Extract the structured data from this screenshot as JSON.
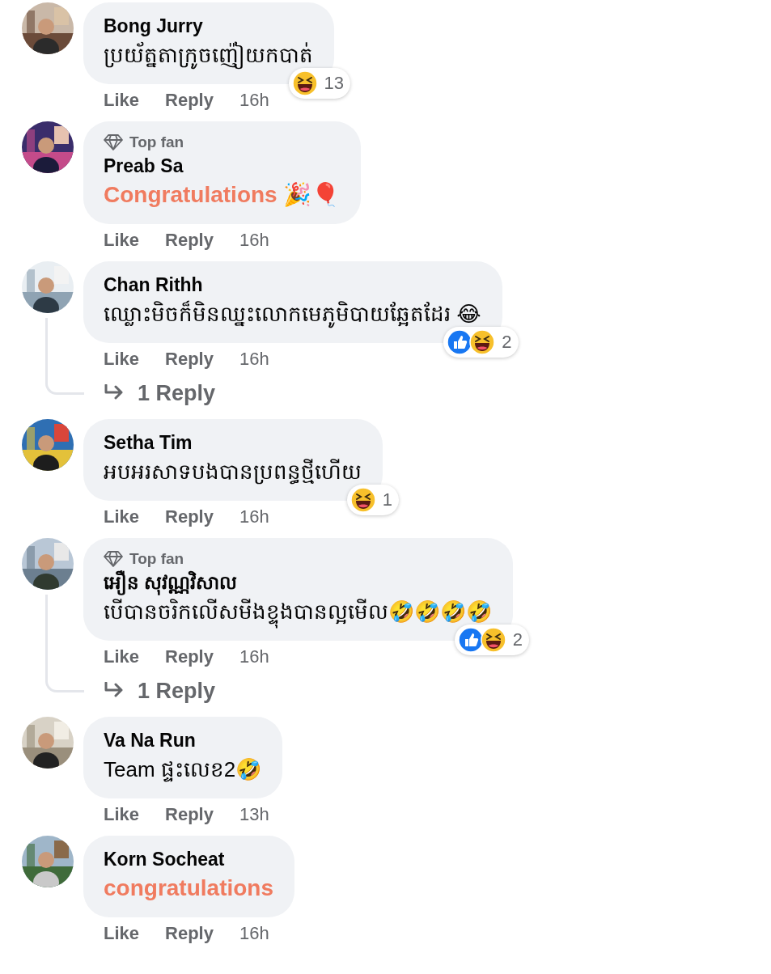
{
  "comments": [
    {
      "author": "Bong Jurry",
      "text": "ប្រយ័ត្នតាក្រូចញ៉ៀយកបាត់",
      "kind": "plain",
      "reactions": [
        {
          "kind": "haha"
        }
      ],
      "reaction_count": "13",
      "actions": [
        "Like",
        "Reply"
      ],
      "time": "16h"
    },
    {
      "badge": "Top fan",
      "author": "Preab Sa",
      "text": "Congratulations 🎉🎈",
      "kind": "celebration",
      "actions": [
        "Like",
        "Reply"
      ],
      "time": "16h"
    },
    {
      "author": "Chan Rithh",
      "text": "ឈ្លោះមិចក៏មិនឈ្នះលោកមេភូមិបាយឆ្អែតដែរ 😂",
      "kind": "plain",
      "reactions": [
        {
          "kind": "like"
        },
        {
          "kind": "haha"
        }
      ],
      "reaction_count": "2",
      "actions": [
        "Like",
        "Reply"
      ],
      "time": "16h",
      "replies_link": "1 Reply"
    },
    {
      "author": "Setha Tim",
      "text": "អបអរសាទបងបានប្រពន្ធថ្មីហើយ",
      "kind": "plain",
      "reactions": [
        {
          "kind": "haha"
        }
      ],
      "reaction_count": "1",
      "actions": [
        "Like",
        "Reply"
      ],
      "time": "16h"
    },
    {
      "badge": "Top fan",
      "author": "អឿន សុវណ្ណវិសាល",
      "text": "បើបានចរិកលើសមីងខ្ទុងបានល្អមើល🤣🤣🤣🤣",
      "kind": "plain",
      "reactions": [
        {
          "kind": "like"
        },
        {
          "kind": "haha"
        }
      ],
      "reaction_count": "2",
      "actions": [
        "Like",
        "Reply"
      ],
      "time": "16h",
      "replies_link": "1 Reply"
    },
    {
      "author": "Va Na Run",
      "text": "Team ផ្ទះលេខ2🤣",
      "kind": "plain",
      "actions": [
        "Like",
        "Reply"
      ],
      "time": "13h"
    },
    {
      "author": "Korn Socheat",
      "text": "congratulations",
      "kind": "celebration",
      "actions": [
        "Like",
        "Reply"
      ],
      "time": "16h"
    }
  ]
}
